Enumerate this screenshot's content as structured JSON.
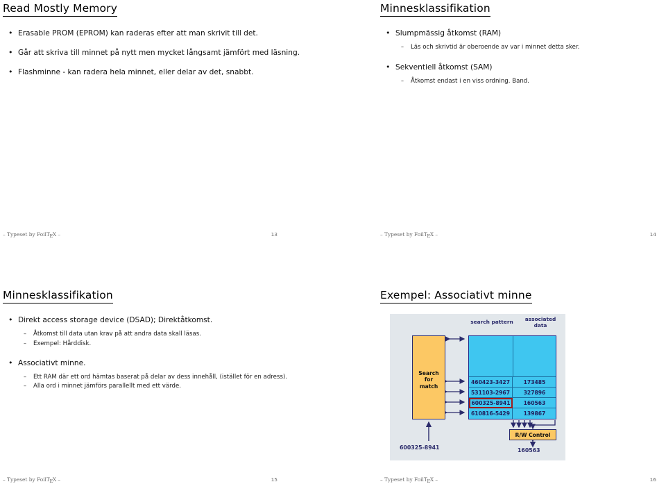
{
  "deck": {
    "footer_prefix": "– Typeset by Foil",
    "footer_tex_t": "T",
    "footer_tex_e": "E",
    "footer_tex_x": "X –"
  },
  "slides": [
    {
      "id": "slide-read-mostly-memory",
      "title": "Read Mostly Memory",
      "page": "13",
      "bullets": [
        {
          "text": "Erasable PROM (EPROM) kan raderas efter att man skrivit till det.",
          "sub": []
        },
        {
          "text": "Går att skriva till minnet på nytt men mycket långsamt jämfört med läsning.",
          "sub": []
        },
        {
          "text": "Flashminne - kan radera hela minnet, eller delar av det, snabbt.",
          "sub": []
        }
      ]
    },
    {
      "id": "slide-minnesklassifikation-1",
      "title": "Minnesklassifikation",
      "page": "14",
      "bullets": [
        {
          "text": "Slumpmässig åtkomst (RAM)",
          "sub": [
            "Läs och skrivtid är oberoende av var i minnet detta sker."
          ]
        },
        {
          "text": "Sekventiell åtkomst (SAM)",
          "sub": [
            "Åtkomst endast i en viss ordning. Band."
          ]
        }
      ]
    },
    {
      "id": "slide-minnesklassifikation-2",
      "title": "Minnesklassifikation",
      "page": "15",
      "bullets": [
        {
          "text": "Direkt access storage device (DSAD); Direktåtkomst.",
          "sub": [
            "Åtkomst till data utan krav på att andra data skall läsas.",
            "Exempel: Hårddisk."
          ]
        },
        {
          "text": "Associativt minne.",
          "sub": [
            "Ett RAM där ett ord hämtas baserat på delar av dess innehåll, (istället för en adress).",
            "Alla ord i minnet jämförs parallellt med ett värde."
          ]
        }
      ]
    },
    {
      "id": "slide-exempel-associativt-minne",
      "title": "Exempel: Associativt minne",
      "page": "16",
      "bullets": []
    }
  ],
  "diagram": {
    "name": "associative-memory-diagram",
    "labels": {
      "search_pattern": "search pattern",
      "associated_data": "associated data",
      "search_box_line1": "Search",
      "search_box_line2": "for",
      "search_box_line3": "match",
      "rw_control": "R/W Control"
    },
    "rows": [
      {
        "pattern": "460423-3427",
        "data": "173485",
        "highlight": false
      },
      {
        "pattern": "531103-2967",
        "data": "327896",
        "highlight": false
      },
      {
        "pattern": "600325-8941",
        "data": "160563",
        "highlight": true
      },
      {
        "pattern": "610816-5429",
        "data": "139867",
        "highlight": false
      }
    ],
    "query_value": "600325-8941",
    "result_value": "160563",
    "colors": {
      "panel_bg": "#e2e7eb",
      "orange_box": "#fcc864",
      "memory_cyan": "#3fc6f0",
      "border_navy": "#2b2b6b",
      "highlight_red": "#a01b1b",
      "text_navy": "#20205e"
    }
  }
}
